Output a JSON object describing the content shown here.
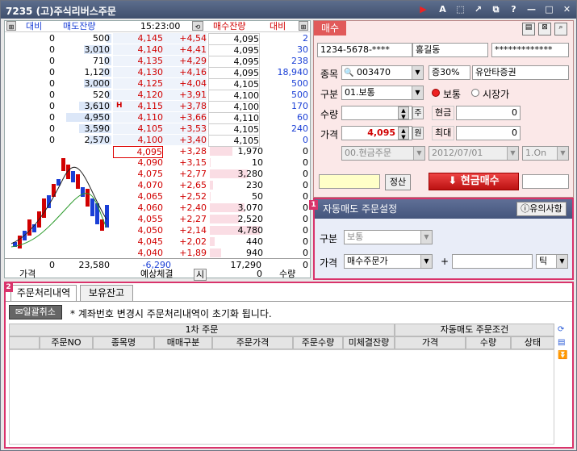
{
  "window": {
    "code": "7235",
    "title": "(고)주식리버스주문",
    "icons": [
      "flag-icon",
      "text-size-icon",
      "select-icon",
      "share-icon",
      "copy-icon",
      "help-icon",
      "minimize-icon",
      "maximize-icon",
      "close-icon"
    ]
  },
  "orderbook": {
    "headers": {
      "left_change": "대비",
      "sell_qty": "매도잔량",
      "time": "15:23:00",
      "buy_qty": "매수잔량",
      "right_change": "대비"
    },
    "asks": [
      {
        "chg": "0",
        "qty": "500",
        "price": "4,145",
        "pct": "+4,54",
        "rq": "4,095",
        "rc": "2"
      },
      {
        "chg": "0",
        "qty": "3,010",
        "price": "4,140",
        "pct": "+4,41",
        "rq": "4,095",
        "rc": "30"
      },
      {
        "chg": "0",
        "qty": "710",
        "price": "4,135",
        "pct": "+4,29",
        "rq": "4,095",
        "rc": "238"
      },
      {
        "chg": "0",
        "qty": "1,120",
        "price": "4,130",
        "pct": "+4,16",
        "rq": "4,095",
        "rc": "18,940"
      },
      {
        "chg": "0",
        "qty": "3,000",
        "price": "4,125",
        "pct": "+4,04",
        "rq": "4,105",
        "rc": "500"
      },
      {
        "chg": "0",
        "qty": "520",
        "price": "4,120",
        "pct": "+3,91",
        "rq": "4,100",
        "rc": "500"
      },
      {
        "chg": "0",
        "qty": "3,610",
        "price": "4,115",
        "pct": "+3,78",
        "rq": "4,100",
        "rc": "170"
      },
      {
        "chg": "0",
        "qty": "4,950",
        "price": "4,110",
        "pct": "+3,66",
        "rq": "4,110",
        "rc": "60"
      },
      {
        "chg": "0",
        "qty": "3,590",
        "price": "4,105",
        "pct": "+3,53",
        "rq": "4,105",
        "rc": "240"
      },
      {
        "chg": "0",
        "qty": "2,570",
        "price": "4,100",
        "pct": "+3,40",
        "rq": "4,105",
        "rc": "0"
      }
    ],
    "ask_bars": [
      0.1,
      0.55,
      0.14,
      0.2,
      0.55,
      0.1,
      0.65,
      0.9,
      0.65,
      0.47
    ],
    "h_marker": "H",
    "bids": [
      {
        "price": "4,095",
        "pct": "+3,28",
        "qty": "1,970",
        "chg": "0"
      },
      {
        "price": "4,090",
        "pct": "+3,15",
        "qty": "10",
        "chg": "0"
      },
      {
        "price": "4,075",
        "pct": "+2,77",
        "qty": "3,280",
        "chg": "0"
      },
      {
        "price": "4,070",
        "pct": "+2,65",
        "qty": "230",
        "chg": "0"
      },
      {
        "price": "4,065",
        "pct": "+2,52",
        "qty": "50",
        "chg": "0"
      },
      {
        "price": "4,060",
        "pct": "+2,40",
        "qty": "3,070",
        "chg": "0"
      },
      {
        "price": "4,055",
        "pct": "+2,27",
        "qty": "2,520",
        "chg": "0"
      },
      {
        "price": "4,050",
        "pct": "+2,14",
        "qty": "4,780",
        "chg": "0"
      },
      {
        "price": "4,045",
        "pct": "+2,02",
        "qty": "440",
        "chg": "0"
      },
      {
        "price": "4,040",
        "pct": "+1,89",
        "qty": "940",
        "chg": "0"
      }
    ],
    "bid_bars": [
      0.45,
      0.02,
      0.75,
      0.06,
      0.02,
      0.7,
      0.58,
      1.0,
      0.1,
      0.22
    ],
    "totals": {
      "left": "0",
      "sell_total": "23,580",
      "diff": "-6,290",
      "buy_total": "17,290",
      "right": "0"
    },
    "footer": {
      "price": "가격",
      "expected": "예상체결",
      "si": "시",
      "zero": "0",
      "qty": "수량"
    }
  },
  "order": {
    "tab": "매수",
    "account": "1234-5678-****",
    "name": "홍길동",
    "password": "*************",
    "stock_label": "종목",
    "stock_code": "003470",
    "margin": "증30%",
    "stock_name": "유안타증권",
    "type_label": "구분",
    "type_value": "01.보통",
    "radio_normal": "보통",
    "radio_market": "시장가",
    "qty_label": "수량",
    "qty_value": "",
    "qty_unit": "주",
    "cash_label": "현금",
    "cash_value": "0",
    "price_label": "가격",
    "price_value": "4,095",
    "price_unit": "원",
    "max_label": "최대",
    "max_value": "0",
    "cond": "00.현금주문",
    "date": "2012/07/01",
    "on": "1.On",
    "reset_btn": "정산",
    "submit_btn": "현금매수"
  },
  "auto": {
    "badge": "1",
    "title": "자동매도 주문설정",
    "notice": "유의사항",
    "type_label": "구분",
    "type_value": "보통",
    "price_label": "가격",
    "price_value": "매수주문가",
    "plus": "+",
    "tick": "틱"
  },
  "bottom": {
    "badge": "2",
    "tabs": [
      "주문처리내역",
      "보유잔고"
    ],
    "cancel_btn": "일괄취소",
    "notice": "* 계좌번호 변경시 주문처리내역이 초기화 됩니다.",
    "group1": "1차 주문",
    "group2": "자동매도 주문조건",
    "cols": [
      "주문NO",
      "종목명",
      "매매구분",
      "주문가격",
      "주문수량",
      "미체결잔량",
      "가격",
      "수량",
      "상태"
    ]
  },
  "colors": {
    "accent": "#d9336b",
    "red": "#d10000",
    "blue": "#1a3fd6"
  }
}
